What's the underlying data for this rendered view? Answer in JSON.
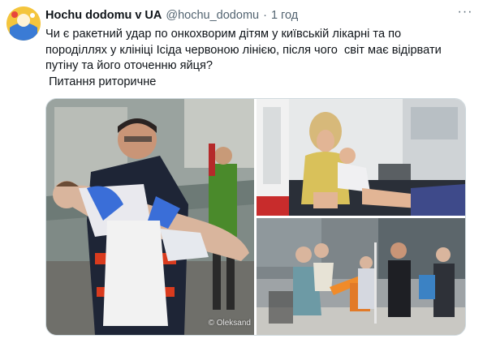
{
  "tweet": {
    "author_name": "Hochu dodomu v UA",
    "handle": "@hochu_dodomu",
    "separator": "·",
    "time": "1 год",
    "more_label": "···",
    "text": "Чи є ракетний удар по онкохворим дітям у київській лікарні та по породіллях у клініці Ісіда червоною лінією, після чого  світ має відірвати путіну та його оточенню яйця?\n Питання риторичне"
  },
  "media": {
    "watermark": "© Oleksand",
    "photos": [
      {
        "name": "doctor-carrying-child-photo"
      },
      {
        "name": "ambulance-mother-child-photo"
      },
      {
        "name": "street-evacuation-photo"
      }
    ]
  },
  "colors": {
    "name": "#0f1419",
    "secondary": "#536471",
    "border": "#cfd9de"
  }
}
